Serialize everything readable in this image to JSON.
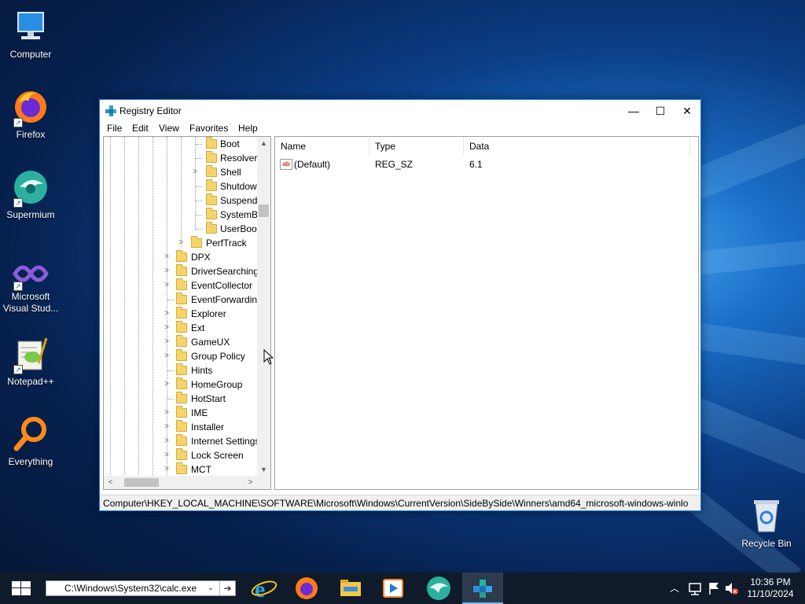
{
  "desktop": {
    "icons": [
      {
        "label": "Computer"
      },
      {
        "label": "Firefox"
      },
      {
        "label": "Supermium"
      },
      {
        "label": "Microsoft Visual Stud..."
      },
      {
        "label": "Notepad++"
      },
      {
        "label": "Everything"
      },
      {
        "label": "Recycle Bin"
      }
    ]
  },
  "window": {
    "title": "Registry Editor",
    "controls": {
      "minimize": "—",
      "maximize": "☐",
      "close": "✕"
    },
    "menu": [
      "File",
      "Edit",
      "View",
      "Favorites",
      "Help"
    ],
    "tree": [
      {
        "name": "Boot",
        "expandable": false
      },
      {
        "name": "Resolver",
        "expandable": false
      },
      {
        "name": "Shell",
        "expandable": true
      },
      {
        "name": "Shutdow",
        "expandable": false
      },
      {
        "name": "Suspend",
        "expandable": false
      },
      {
        "name": "SystemB",
        "expandable": false
      },
      {
        "name": "UserBoo",
        "expandable": false
      },
      {
        "name": "PerfTrack",
        "expandable": true
      },
      {
        "name": "DPX",
        "expandable": true
      },
      {
        "name": "DriverSearching",
        "expandable": true
      },
      {
        "name": "EventCollector",
        "expandable": true
      },
      {
        "name": "EventForwardin",
        "expandable": false
      },
      {
        "name": "Explorer",
        "expandable": true
      },
      {
        "name": "Ext",
        "expandable": true
      },
      {
        "name": "GameUX",
        "expandable": true
      },
      {
        "name": "Group Policy",
        "expandable": true
      },
      {
        "name": "Hints",
        "expandable": false
      },
      {
        "name": "HomeGroup",
        "expandable": true
      },
      {
        "name": "HotStart",
        "expandable": false
      },
      {
        "name": "IME",
        "expandable": true
      },
      {
        "name": "Installer",
        "expandable": true
      },
      {
        "name": "Internet Settings",
        "expandable": true
      },
      {
        "name": "Lock Screen",
        "expandable": true
      },
      {
        "name": "MCT",
        "expandable": true
      }
    ],
    "columns": {
      "name": "Name",
      "type": "Type",
      "data": "Data"
    },
    "values": [
      {
        "name": "(Default)",
        "type": "REG_SZ",
        "data": "6.1",
        "icon": "ab"
      }
    ],
    "status_path": "Computer\\HKEY_LOCAL_MACHINE\\SOFTWARE\\Microsoft\\Windows\\CurrentVersion\\SideBySide\\Winners\\amd64_microsoft-windows-winlo"
  },
  "taskbar": {
    "run_value": "C:\\Windows\\System32\\calc.exe",
    "apps": [
      "internet-explorer-icon",
      "firefox-icon",
      "file-explorer-icon",
      "media-player-icon",
      "supermium-icon",
      "registry-editor-icon"
    ],
    "clock_time": "10:36 PM",
    "clock_date": "11/10/2024"
  },
  "colors": {
    "accent": "#1883d7",
    "taskbar": "#0f1b2a",
    "folder": "#f5d46b"
  }
}
